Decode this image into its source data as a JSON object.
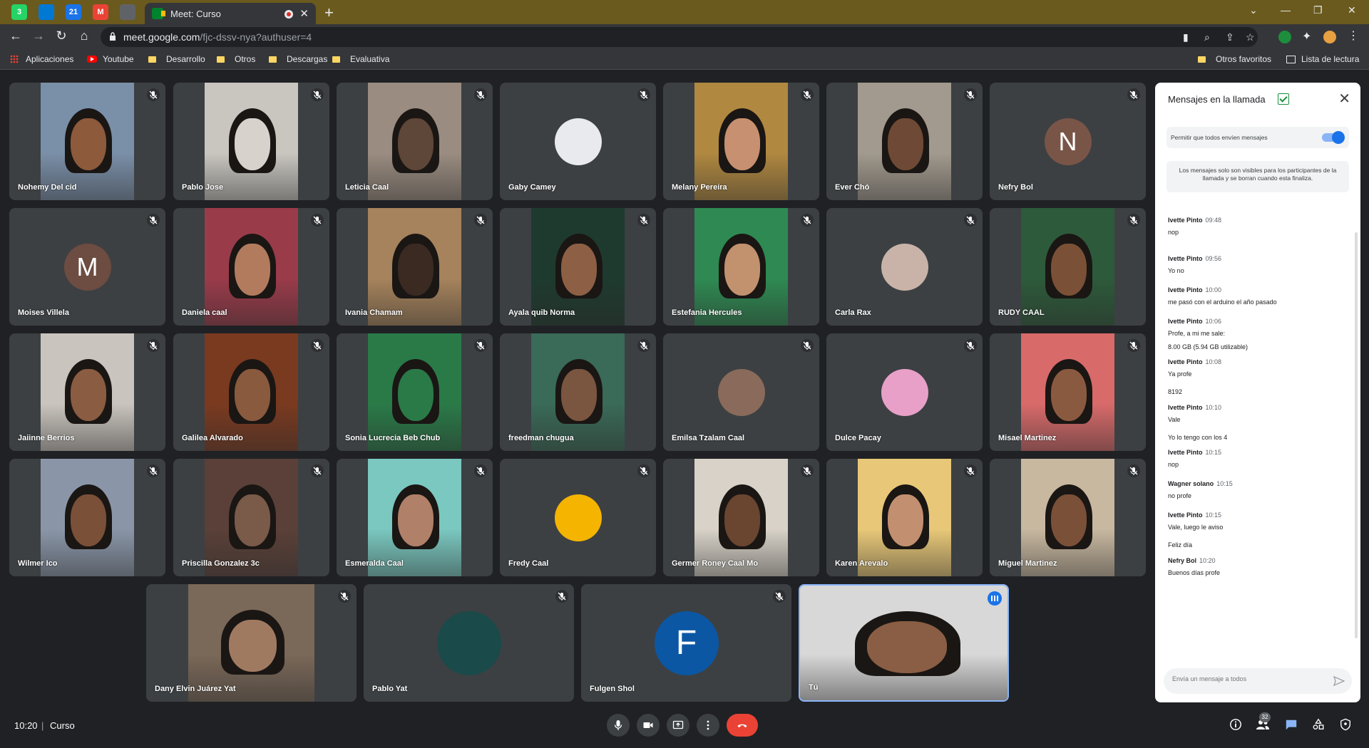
{
  "browser": {
    "tab_title": "Meet: Curso",
    "url_host": "meet.google.com",
    "url_path": "/fjc-dssv-nya?authuser=4",
    "pinned_tabs": [
      {
        "icon": "whatsapp-icon",
        "label": "3",
        "color": "#25d366"
      },
      {
        "icon": "onedrive-icon",
        "label": "",
        "color": "#0078d4"
      },
      {
        "icon": "calendar-icon",
        "label": "21",
        "color": "#1a73e8"
      },
      {
        "icon": "gmail-icon",
        "label": "M",
        "color": "#ea4335"
      },
      {
        "icon": "extension-icon",
        "label": "",
        "color": "#5f6368"
      }
    ],
    "bookmarks": [
      {
        "label": "Aplicaciones",
        "icon": "apps-grid-icon"
      },
      {
        "label": "Youtube",
        "icon": "youtube-icon"
      },
      {
        "label": "Desarrollo",
        "icon": "folder-icon"
      },
      {
        "label": "Otros",
        "icon": "folder-icon"
      },
      {
        "label": "Descargas",
        "icon": "folder-icon"
      },
      {
        "label": "Evaluativa",
        "icon": "folder-icon"
      },
      {
        "label": "Otros favoritos",
        "icon": "folder-icon"
      },
      {
        "label": "Lista de lectura",
        "icon": "reading-list-icon"
      }
    ]
  },
  "participants": [
    {
      "name": "Nohemy Del cid",
      "type": "video",
      "bg": "#7a8fa8",
      "skin": "#8d5a3c",
      "muted": true
    },
    {
      "name": "Pablo Jose",
      "type": "video",
      "bg": "#c9c6c0",
      "skin": "#d7d3cc",
      "muted": true
    },
    {
      "name": "Leticia Caal",
      "type": "video",
      "bg": "#9a8c80",
      "skin": "#5e4638",
      "muted": true
    },
    {
      "name": "Gaby Camey",
      "type": "avatar",
      "avatar_color": "#e8eaed",
      "letter": "",
      "muted": true
    },
    {
      "name": "Melany Pereira",
      "type": "video",
      "bg": "#b08840",
      "skin": "#c79070",
      "muted": true
    },
    {
      "name": "Ever Chó",
      "type": "video",
      "bg": "#a29a8e",
      "skin": "#6e4a36",
      "muted": true
    },
    {
      "name": "Nefry Bol",
      "type": "avatar",
      "avatar_color": "#795548",
      "letter": "N",
      "muted": true
    },
    {
      "name": "Moises Villela",
      "type": "avatar",
      "avatar_color": "#6d4c41",
      "letter": "M",
      "muted": true
    },
    {
      "name": "Daniela caal",
      "type": "video",
      "bg": "#9a3b4a",
      "skin": "#b27b5e",
      "muted": true
    },
    {
      "name": "Ivania Chamam",
      "type": "video",
      "bg": "#a6835c",
      "skin": "#3a2a22",
      "muted": true
    },
    {
      "name": "Ayala quib Norma",
      "type": "video",
      "bg": "#1e3a2e",
      "skin": "#8d5f44",
      "muted": true
    },
    {
      "name": "Estefania Hercules",
      "type": "video",
      "bg": "#2e8a52",
      "skin": "#c2916e",
      "muted": true
    },
    {
      "name": "Carla Rax",
      "type": "avatar",
      "avatar_color": "#c9b3a8",
      "letter": "",
      "muted": true
    },
    {
      "name": "RUDY CAAL",
      "type": "video",
      "bg": "#2d5a3a",
      "skin": "#7a5036",
      "muted": true
    },
    {
      "name": "Jaiinne Berrios",
      "type": "video",
      "bg": "#c9c4bd",
      "skin": "#8a5c42",
      "muted": true
    },
    {
      "name": "Galilea Alvarado",
      "type": "video",
      "bg": "#7a3a20",
      "skin": "#8a5a3e",
      "muted": true
    },
    {
      "name": "Sonia Lucrecia Beb Chub",
      "type": "video",
      "bg": "#2a7a48",
      "skin": "#2a7a48",
      "muted": true
    },
    {
      "name": "freedman chugua",
      "type": "video",
      "bg": "#3a6a58",
      "skin": "#7a5540",
      "muted": true
    },
    {
      "name": "Emilsa Tzalam Caal",
      "type": "avatar",
      "avatar_color": "#8a6a5a",
      "letter": "",
      "muted": true
    },
    {
      "name": "Dulce Pacay",
      "type": "avatar",
      "avatar_color": "#e8a0c8",
      "letter": "",
      "muted": true
    },
    {
      "name": "Misael Martinez",
      "type": "video",
      "bg": "#d86a6a",
      "skin": "#8a5a40",
      "muted": true
    },
    {
      "name": "Wilmer Ico",
      "type": "video",
      "bg": "#8a96a8",
      "skin": "#7a5038",
      "muted": true
    },
    {
      "name": "Priscilla Gonzalez 3c",
      "type": "video",
      "bg": "#5a4038",
      "skin": "#7a5a48",
      "muted": true
    },
    {
      "name": "Esmeralda Caal",
      "type": "video",
      "bg": "#7ac8c0",
      "skin": "#b08068",
      "muted": true
    },
    {
      "name": "Fredy Caal",
      "type": "avatar",
      "avatar_color": "#f4b400",
      "letter": "",
      "muted": true
    },
    {
      "name": "Germer Roney Caal Mo",
      "type": "video",
      "bg": "#d8d2c8",
      "skin": "#6a4530",
      "muted": true
    },
    {
      "name": "Karen Arevalo",
      "type": "video",
      "bg": "#e8c878",
      "skin": "#c29070",
      "muted": true
    },
    {
      "name": "Miguel Martinez",
      "type": "video",
      "bg": "#c8b8a0",
      "skin": "#7a5038",
      "muted": true
    },
    {
      "name": "Dany Elvin Juárez Yat",
      "type": "video",
      "bg": "#7a6858",
      "skin": "#a07a60",
      "muted": true
    },
    {
      "name": "Pablo Yat",
      "type": "avatar",
      "avatar_color": "#1a4a4a",
      "letter": "",
      "muted": true
    },
    {
      "name": "Fulgen Shol",
      "type": "avatar",
      "avatar_color": "#0b57a4",
      "letter": "F",
      "muted": true
    },
    {
      "name": "Tú",
      "type": "video",
      "bg": "#d8d8d8",
      "skin": "#8a5e44",
      "muted": false,
      "self": true
    }
  ],
  "chat": {
    "title": "Mensajes en la llamada",
    "allow_label": "Permitir que todos envíen mensajes",
    "allow_enabled": true,
    "info": "Los mensajes solo son visibles para los participantes de la llamada y se borran cuando esta finaliza.",
    "input_placeholder": "Envía un mensaje a todos",
    "messages": [
      {
        "sender": "Ivette Pinto",
        "time": "09:48",
        "lines": [
          "nop"
        ]
      },
      {
        "sender": "Ivette Pinto",
        "time": "09:56",
        "lines": [
          "Yo no"
        ]
      },
      {
        "sender": "Ivette Pinto",
        "time": "10:00",
        "lines": [
          "me pasó con el arduino el año pasado"
        ]
      },
      {
        "sender": "Ivette Pinto",
        "time": "10:06",
        "lines": [
          "Profe, a mi me sale:",
          "8.00 GB (5.94 GB utilizable)"
        ]
      },
      {
        "sender": "Ivette Pinto",
        "time": "10:08",
        "lines": [
          "Ya profe",
          "",
          "8192"
        ]
      },
      {
        "sender": "Ivette Pinto",
        "time": "10:10",
        "lines": [
          "Vale",
          "",
          "Yo lo tengo con los 4"
        ]
      },
      {
        "sender": "Ivette Pinto",
        "time": "10:15",
        "lines": [
          "nop"
        ]
      },
      {
        "sender": "Wagner solano",
        "time": "10:15",
        "lines": [
          "no profe"
        ]
      },
      {
        "sender": "Ivette Pinto",
        "time": "10:15",
        "lines": [
          "Vale, luego le aviso",
          "",
          "Feliz día"
        ]
      },
      {
        "sender": "Nefry Bol",
        "time": "10:20",
        "lines": [
          "Buenos días profe"
        ]
      }
    ]
  },
  "meeting": {
    "time": "10:20",
    "separator": "|",
    "name": "Curso",
    "participant_count": "32"
  },
  "colors": {
    "tab_strip": "#6b5a1e",
    "hangup": "#ea4335",
    "accent": "#1a73e8"
  }
}
